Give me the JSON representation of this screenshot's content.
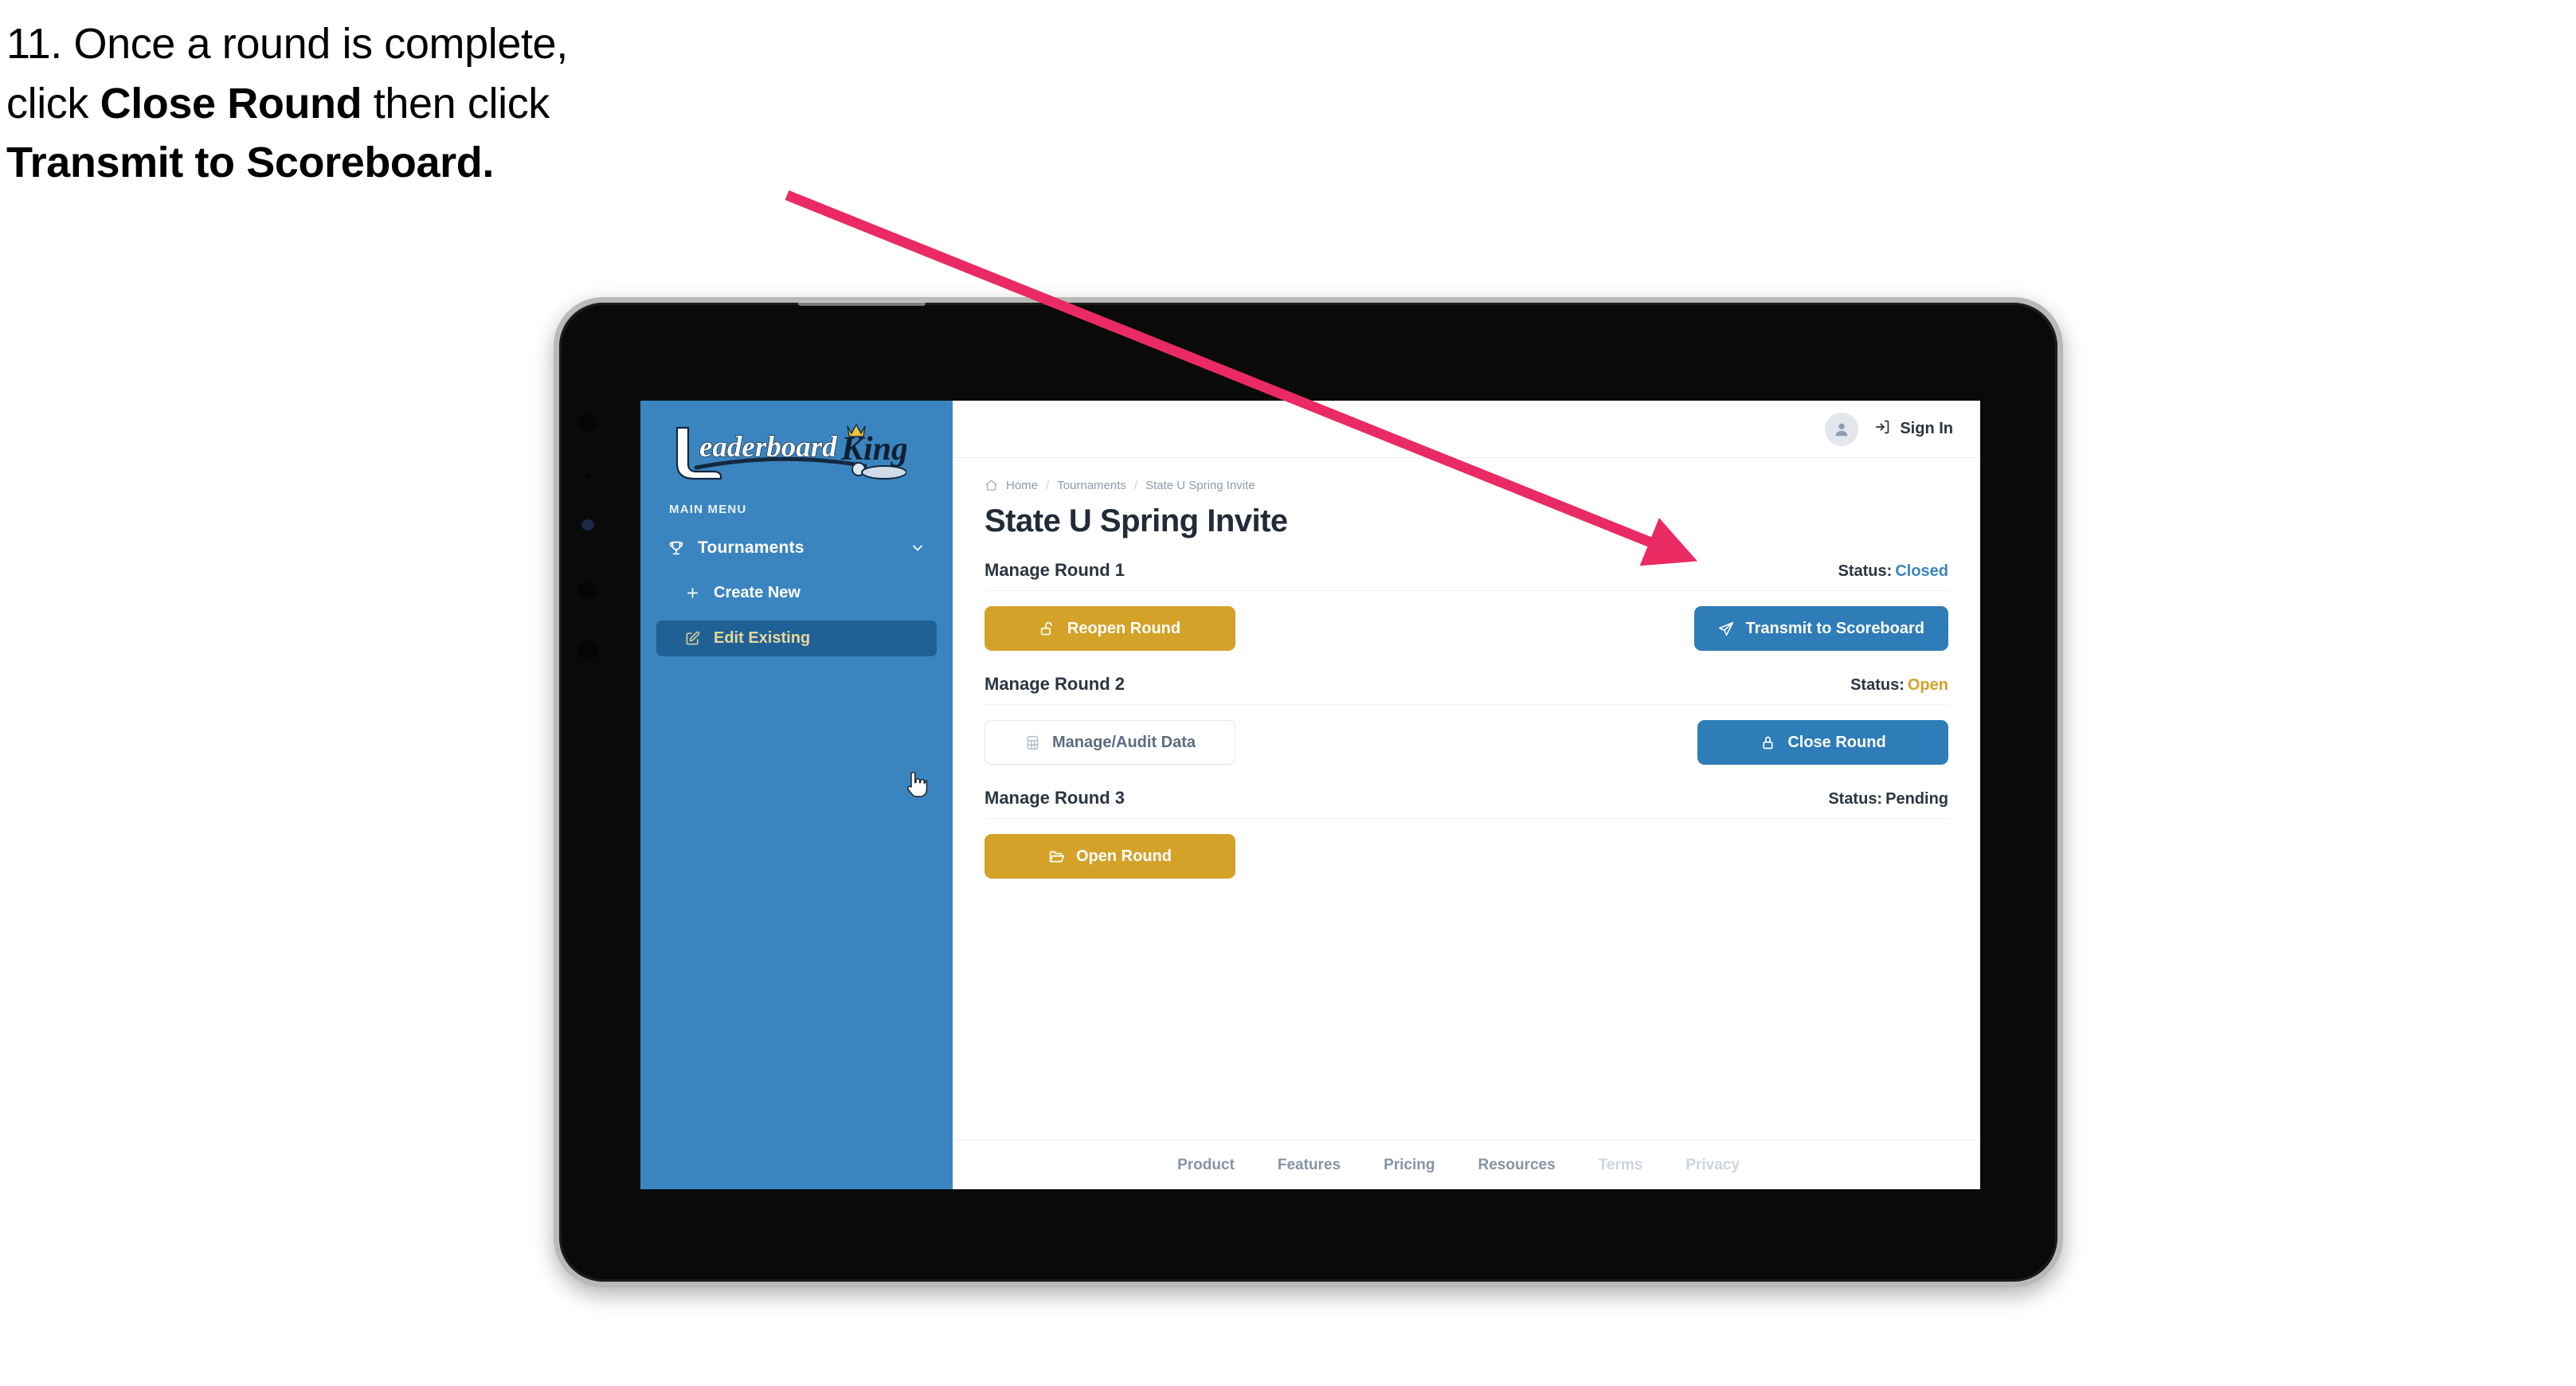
{
  "caption": {
    "line1_prefix": "11. Once a round is complete,",
    "line2_pre": "click ",
    "line2_bold": "Close Round",
    "line2_post": " then click",
    "line3_bold": "Transmit to Scoreboard."
  },
  "colors": {
    "sidebar_blue": "#3a85c0",
    "sidebar_active": "#1f6195",
    "sidebar_active_text": "#e8d79a",
    "gold": "#d4a229",
    "blue": "#2e7cb8",
    "status_closed": "#3a85c0",
    "status_open": "#d4a229",
    "status_pending": "#2b3542",
    "arrow_pink": "#ea2a63",
    "device_frame": "#b9b9b9",
    "device_bezel": "#0a0a0a"
  },
  "sidebar": {
    "logo_text_primary": "Leaderboard",
    "logo_text_secondary": "King",
    "menu_label": "MAIN MENU",
    "items": [
      {
        "label": "Tournaments",
        "icon": "trophy-icon",
        "chevron": "chevron-down-icon",
        "type": "group"
      },
      {
        "label": "Create New",
        "icon": "plus-icon",
        "type": "sub",
        "active": false
      },
      {
        "label": "Edit Existing",
        "icon": "edit-pencil-icon",
        "type": "sub",
        "active": true
      }
    ]
  },
  "header": {
    "avatar_icon": "user-avatar-icon",
    "signin_icon": "login-arrow-icon",
    "signin_label": "Sign In"
  },
  "breadcrumb": {
    "home_icon": "home-icon",
    "items": [
      "Home",
      "Tournaments",
      "State U Spring Invite"
    ],
    "separator": "/"
  },
  "page": {
    "title": "State U Spring Invite"
  },
  "rounds": [
    {
      "name": "Manage Round 1",
      "status_label": "Status:",
      "status_value": "Closed",
      "status_color": "#3a85c0",
      "left_button": {
        "label": "Reopen Round",
        "icon": "unlock-icon",
        "style": "gold"
      },
      "right_button": {
        "label": "Transmit to Scoreboard",
        "icon": "paper-plane-icon",
        "style": "blue"
      }
    },
    {
      "name": "Manage Round 2",
      "status_label": "Status:",
      "status_value": "Open",
      "status_color": "#d4a229",
      "left_button": {
        "label": "Manage/Audit Data",
        "icon": "table-grid-icon",
        "style": "ghost"
      },
      "right_button": {
        "label": "Close Round",
        "icon": "lock-icon",
        "style": "blue"
      }
    },
    {
      "name": "Manage Round 3",
      "status_label": "Status:",
      "status_value": "Pending",
      "status_color": "#2b3542",
      "left_button": {
        "label": "Open Round",
        "icon": "folder-open-icon",
        "style": "gold"
      },
      "right_button": null
    }
  ],
  "footer": {
    "links": [
      {
        "label": "Product",
        "muted": false
      },
      {
        "label": "Features",
        "muted": false
      },
      {
        "label": "Pricing",
        "muted": false
      },
      {
        "label": "Resources",
        "muted": false
      },
      {
        "label": "Terms",
        "muted": true
      },
      {
        "label": "Privacy",
        "muted": true
      }
    ]
  },
  "annotation": {
    "arrow_icon": "pointer-arrow-icon",
    "target": "Transmit to Scoreboard"
  }
}
